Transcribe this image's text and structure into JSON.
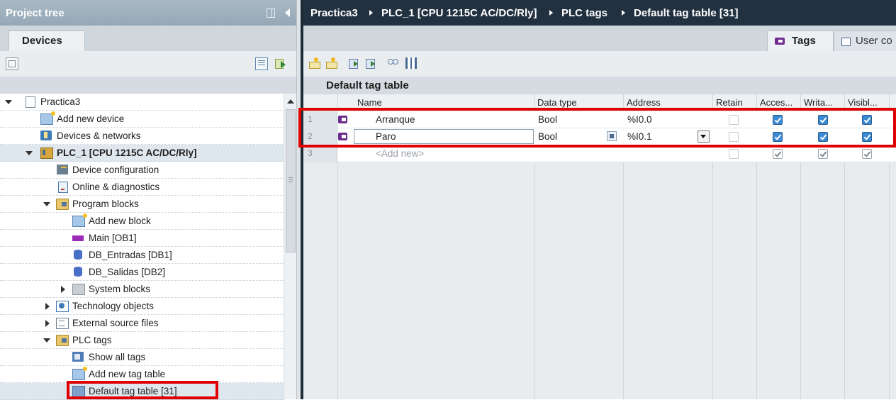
{
  "project_tree": {
    "title": "Project tree",
    "tab": "Devices",
    "items": [
      {
        "label": "Practica3",
        "bold": false
      },
      {
        "label": "Add new device",
        "bold": false
      },
      {
        "label": "Devices & networks",
        "bold": false
      },
      {
        "label": "PLC_1 [CPU 1215C AC/DC/Rly]",
        "bold": true
      },
      {
        "label": "Device configuration",
        "bold": false
      },
      {
        "label": "Online & diagnostics",
        "bold": false
      },
      {
        "label": "Program blocks",
        "bold": false
      },
      {
        "label": "Add new block",
        "bold": false
      },
      {
        "label": "Main [OB1]",
        "bold": false
      },
      {
        "label": "DB_Entradas [DB1]",
        "bold": false
      },
      {
        "label": "DB_Salidas [DB2]",
        "bold": false
      },
      {
        "label": "System blocks",
        "bold": false
      },
      {
        "label": "Technology objects",
        "bold": false
      },
      {
        "label": "External source files",
        "bold": false
      },
      {
        "label": "PLC tags",
        "bold": false
      },
      {
        "label": "Show all tags",
        "bold": false
      },
      {
        "label": "Add new tag table",
        "bold": false
      },
      {
        "label": "Default tag table [31]",
        "bold": false
      }
    ]
  },
  "breadcrumb": [
    "Practica3",
    "PLC_1 [CPU 1215C AC/DC/Rly]",
    "PLC tags",
    "Default tag table [31]"
  ],
  "editor_tabs": {
    "tags": "Tags",
    "user": "User co"
  },
  "table": {
    "title": "Default tag table",
    "columns": [
      "Name",
      "Data type",
      "Address",
      "Retain",
      "Acces...",
      "Writa...",
      "Visibl..."
    ],
    "rows": [
      {
        "num": "1",
        "name": "Arranque",
        "type": "Bool",
        "address": "%I0.0",
        "retain": false,
        "accessible": true,
        "writable": true,
        "visible": true
      },
      {
        "num": "2",
        "name": "Paro",
        "type": "Bool",
        "address": "%I0.1",
        "retain": false,
        "accessible": true,
        "writable": true,
        "visible": true
      },
      {
        "num": "3",
        "name": "<Add new>",
        "type": "",
        "address": "",
        "retain": false,
        "accessible": true,
        "writable": true,
        "visible": true
      }
    ]
  },
  "colors": {
    "breadcrumb_bg": "#223140",
    "highlight_red": "#e00000",
    "checkbox_blue": "#3b8bd4",
    "tag_icon_purple": "#6f2c8f"
  }
}
